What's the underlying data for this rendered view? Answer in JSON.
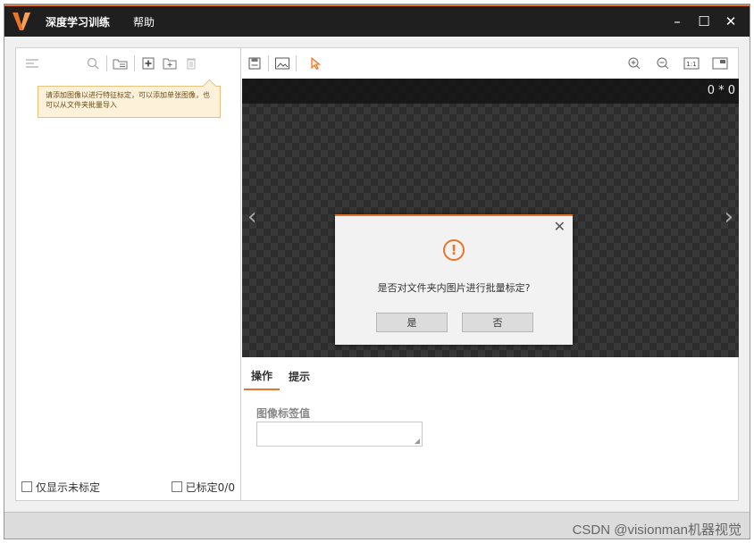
{
  "menu": {
    "app": "深度学习训练",
    "help": "帮助"
  },
  "window": {
    "minimize": "–",
    "maximize": "☐",
    "close": "✕"
  },
  "left_toolbar": {
    "tooltip": "请添加图像以进行特征标定，可以添加单张图像，也可以从文件夹批量导入"
  },
  "left_footer": {
    "only_unlabeled": "仅显示未标定",
    "labeled_count": "已标定0/0"
  },
  "canvas": {
    "size": "0 * 0",
    "prev": "‹",
    "next": "›"
  },
  "dialog": {
    "message": "是否对文件夹内图片进行批量标定?",
    "yes": "是",
    "no": "否",
    "close": "✕",
    "icon": "!"
  },
  "tabs": [
    {
      "label": "操作"
    },
    {
      "label": "提示"
    }
  ],
  "field": {
    "label": "图像标签值",
    "value": ""
  },
  "watermark": "CSDN @visionman机器视觉",
  "colors": {
    "accent": "#e8742a",
    "titlebar": "#1f1f1f"
  }
}
